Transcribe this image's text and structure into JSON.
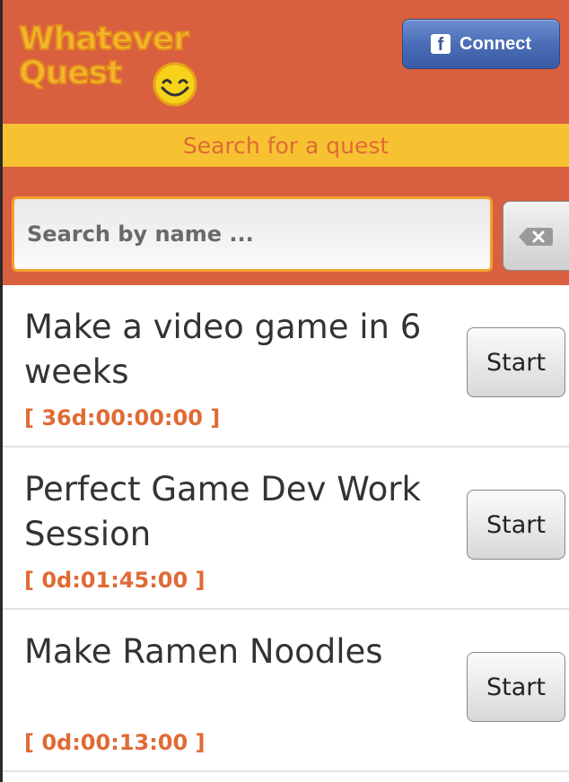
{
  "header": {
    "logo_line1": "Whatever",
    "logo_line2": "Quest",
    "connect_label": "Connect",
    "fb_icon_glyph": "f",
    "background": "#d9603f"
  },
  "banner": {
    "text": "Search for a quest",
    "background": "#f6c232",
    "color": "#e06a35"
  },
  "search": {
    "placeholder": "Search by name ...",
    "value": "",
    "clear_icon": "backspace-clear-icon"
  },
  "quests": [
    {
      "title": "Make a video game in 6 weeks",
      "time": "[ 36d:00:00:00 ]",
      "action": "Start"
    },
    {
      "title": "Perfect Game Dev Work Session",
      "time": "[ 0d:01:45:00 ]",
      "action": "Start"
    },
    {
      "title": "Make Ramen Noodles",
      "time": "[ 0d:00:13:00 ]",
      "action": "Start"
    }
  ],
  "colors": {
    "accent_orange": "#e06a35",
    "title_text": "#333333",
    "facebook_blue": "#3b5998"
  }
}
